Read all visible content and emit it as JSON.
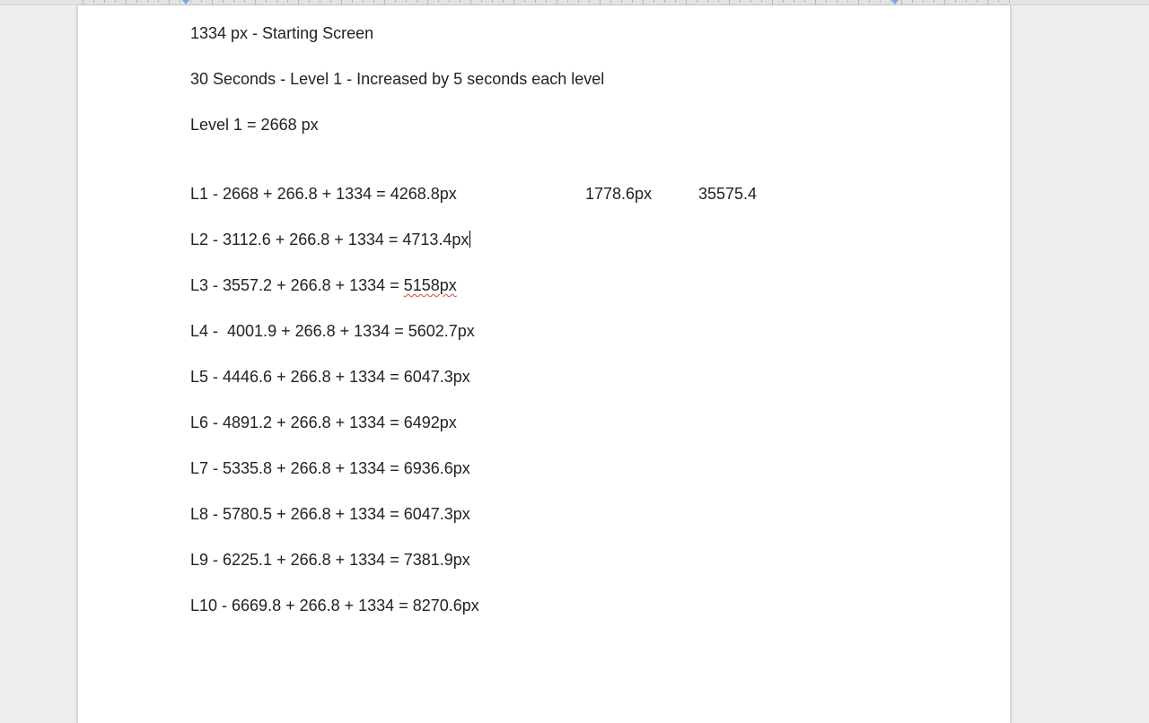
{
  "document": {
    "lines": [
      "1334 px - Starting Screen",
      "30 Seconds - Level 1 - Increased by 5 seconds each level",
      "Level 1 = 2668 px",
      "L1 - 2668 + 266.8 + 1334 = 4268.8px",
      "L2 - 3112.6 + 266.8 + 1334 = 4713.4px",
      "L3 - 3557.2 + 266.8 + 1334 = ",
      "L4 -  4001.9 + 266.8 + 1334 = 5602.7px",
      "L5 - 4446.6 + 266.8 + 1334 = 6047.3px",
      "L6 - 4891.2 + 266.8 + 1334 = 6492px",
      "L7 - 5335.8 + 266.8 + 1334 = 6936.6px",
      "L8 - 5780.5 + 266.8 + 1334 = 6047.3px",
      "L9 - 6225.1 + 266.8 + 1334 = 7381.9px",
      "L10 - 6669.8 + 266.8 + 1334 = 8270.6px"
    ],
    "l3_misspelled_result": "5158px",
    "l1_extra_value_1": "1778.6px",
    "l1_extra_value_2": "35575.4"
  }
}
